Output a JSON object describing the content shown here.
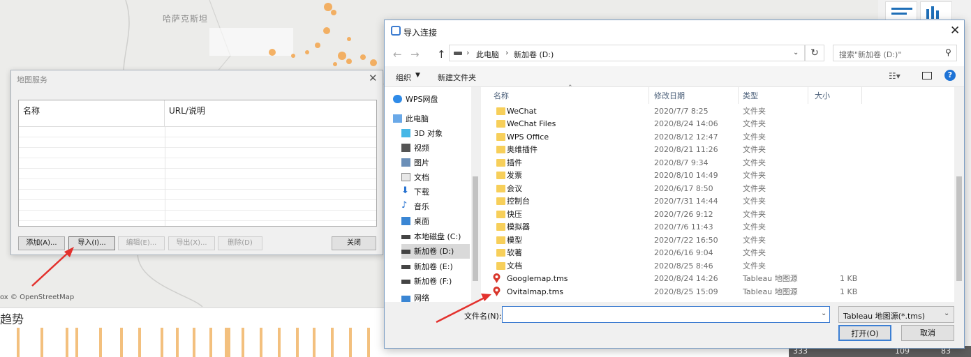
{
  "background": {
    "map_label": "哈萨克斯坦",
    "attribution": "ox © OpenStreetMap",
    "trend_title": "趋势",
    "status_values": [
      "333",
      "109",
      "83"
    ]
  },
  "map_dialog": {
    "title": "地图服务",
    "columns": [
      "名称",
      "URL/说明"
    ],
    "buttons": {
      "add": "添加(A)...",
      "import": "导入(I)...",
      "edit": "编辑(E)...",
      "export": "导出(X)...",
      "delete": "删除(D)",
      "close": "关闭"
    }
  },
  "file_dialog": {
    "title": "导入连接",
    "breadcrumb": [
      "此电脑",
      "新加卷 (D:)"
    ],
    "search_placeholder": "搜索\"新加卷 (D:)\"",
    "toolbar": {
      "organize": "组织",
      "new_folder": "新建文件夹"
    },
    "nav_items": [
      {
        "label": "WPS网盘",
        "icon": "cloud-icon"
      },
      {
        "label": "此电脑",
        "icon": "computer-icon"
      },
      {
        "label": "3D 对象",
        "icon": "cube-icon"
      },
      {
        "label": "视频",
        "icon": "video-icon"
      },
      {
        "label": "图片",
        "icon": "picture-icon"
      },
      {
        "label": "文档",
        "icon": "document-icon"
      },
      {
        "label": "下载",
        "icon": "download-icon"
      },
      {
        "label": "音乐",
        "icon": "music-icon"
      },
      {
        "label": "桌面",
        "icon": "desktop-icon"
      },
      {
        "label": "本地磁盘 (C:)",
        "icon": "drive-icon"
      },
      {
        "label": "新加卷 (D:)",
        "icon": "drive-icon"
      },
      {
        "label": "新加卷 (E:)",
        "icon": "drive-icon"
      },
      {
        "label": "新加卷 (F:)",
        "icon": "drive-icon"
      },
      {
        "label": "网络",
        "icon": "network-icon"
      }
    ],
    "columns": {
      "name": "名称",
      "date": "修改日期",
      "type": "类型",
      "size": "大小"
    },
    "files": [
      {
        "name": "WeChat",
        "date": "2020/7/7 8:25",
        "type": "文件夹",
        "size": ""
      },
      {
        "name": "WeChat Files",
        "date": "2020/8/24 14:06",
        "type": "文件夹",
        "size": ""
      },
      {
        "name": "WPS Office",
        "date": "2020/8/12 12:47",
        "type": "文件夹",
        "size": ""
      },
      {
        "name": "奥维插件",
        "date": "2020/8/21 11:26",
        "type": "文件夹",
        "size": ""
      },
      {
        "name": "插件",
        "date": "2020/8/7 9:34",
        "type": "文件夹",
        "size": ""
      },
      {
        "name": "发票",
        "date": "2020/8/10 14:49",
        "type": "文件夹",
        "size": ""
      },
      {
        "name": "会议",
        "date": "2020/6/17 8:50",
        "type": "文件夹",
        "size": ""
      },
      {
        "name": "控制台",
        "date": "2020/7/31 14:44",
        "type": "文件夹",
        "size": ""
      },
      {
        "name": "快压",
        "date": "2020/7/26 9:12",
        "type": "文件夹",
        "size": ""
      },
      {
        "name": "模拟器",
        "date": "2020/7/6 11:43",
        "type": "文件夹",
        "size": ""
      },
      {
        "name": "模型",
        "date": "2020/7/22 16:50",
        "type": "文件夹",
        "size": ""
      },
      {
        "name": "软著",
        "date": "2020/6/16 9:04",
        "type": "文件夹",
        "size": ""
      },
      {
        "name": "文档",
        "date": "2020/8/25 8:46",
        "type": "文件夹",
        "size": ""
      },
      {
        "name": "Googlemap.tms",
        "date": "2020/8/24 14:26",
        "type": "Tableau 地图源",
        "size": "1 KB"
      },
      {
        "name": "Ovitalmap.tms",
        "date": "2020/8/25 15:09",
        "type": "Tableau 地图源",
        "size": "1 KB"
      }
    ],
    "filename_label": "文件名(N):",
    "filename_value": "",
    "filetype": "Tableau 地图源(*.tms)",
    "buttons": {
      "open": "打开(O)",
      "cancel": "取消"
    }
  }
}
